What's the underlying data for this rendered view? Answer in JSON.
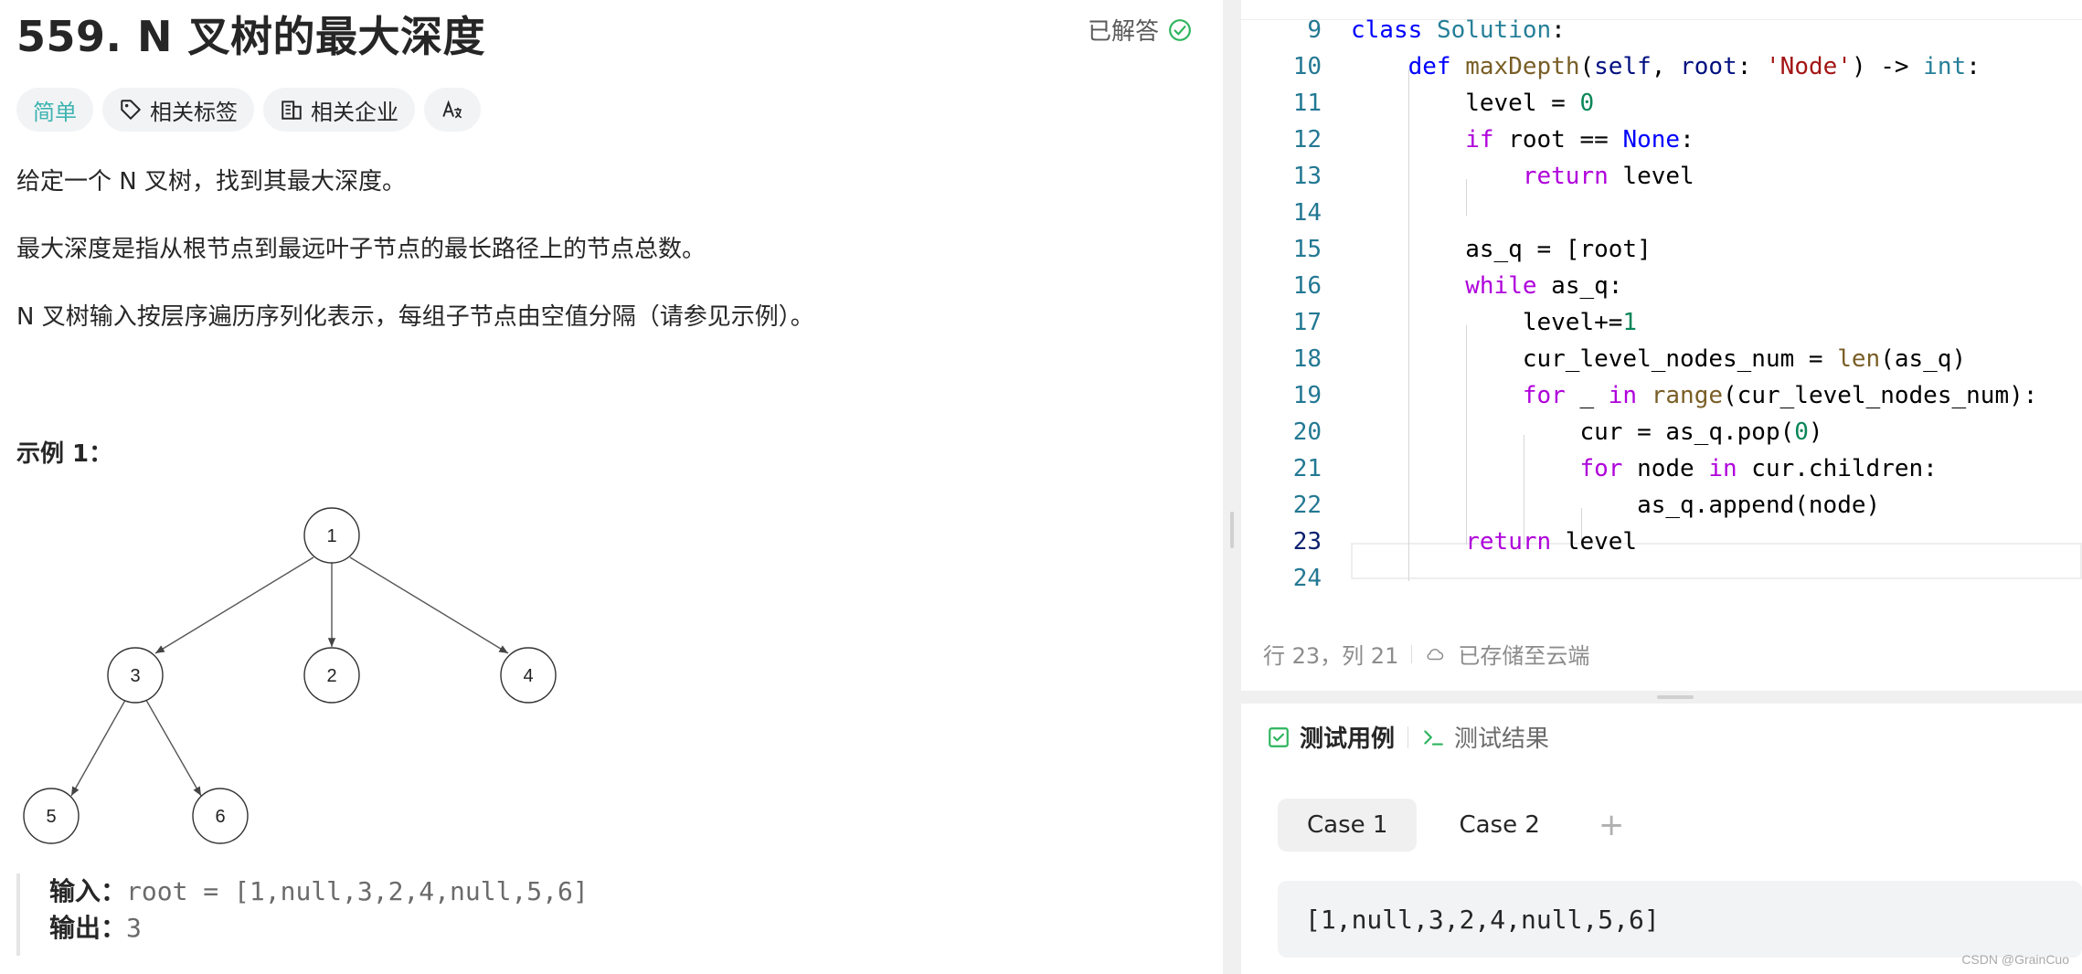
{
  "problem": {
    "title": "559. N 叉树的最大深度",
    "status": "已解答",
    "tags": {
      "difficulty": "简单",
      "related_tags": "相关标签",
      "related_companies": "相关企业",
      "translate_icon": "translate-icon"
    },
    "description": [
      "给定一个 N 叉树，找到其最大深度。",
      "最大深度是指从根节点到最远叶子节点的最长路径上的节点总数。",
      "N 叉树输入按层序遍历序列化表示，每组子节点由空值分隔（请参见示例）。"
    ],
    "example_title": "示例 1：",
    "tree_nodes": [
      "1",
      "3",
      "2",
      "4",
      "5",
      "6"
    ],
    "input_label": "输入：",
    "input_value": "root = [1,null,3,2,4,null,5,6]",
    "output_label": "输出：",
    "output_value": "3"
  },
  "editor": {
    "lines": [
      {
        "n": "9"
      },
      {
        "n": "10"
      },
      {
        "n": "11"
      },
      {
        "n": "12"
      },
      {
        "n": "13"
      },
      {
        "n": "14"
      },
      {
        "n": "15"
      },
      {
        "n": "16"
      },
      {
        "n": "17"
      },
      {
        "n": "18"
      },
      {
        "n": "19"
      },
      {
        "n": "20"
      },
      {
        "n": "21"
      },
      {
        "n": "22"
      },
      {
        "n": "23"
      },
      {
        "n": "24"
      }
    ],
    "status_position": "行 23，列 21",
    "status_saved": "已存储至云端"
  },
  "test_panel": {
    "tab_cases": "测试用例",
    "tab_results": "测试结果",
    "cases": [
      "Case 1",
      "Case 2"
    ],
    "add_case": "+",
    "input_value": "[1,null,3,2,4,null,5,6]"
  },
  "watermark": "CSDN @GrainCuo",
  "colors": {
    "easy": "#3db4b0",
    "solved_check": "#2db55d",
    "line_number": "#237893"
  }
}
